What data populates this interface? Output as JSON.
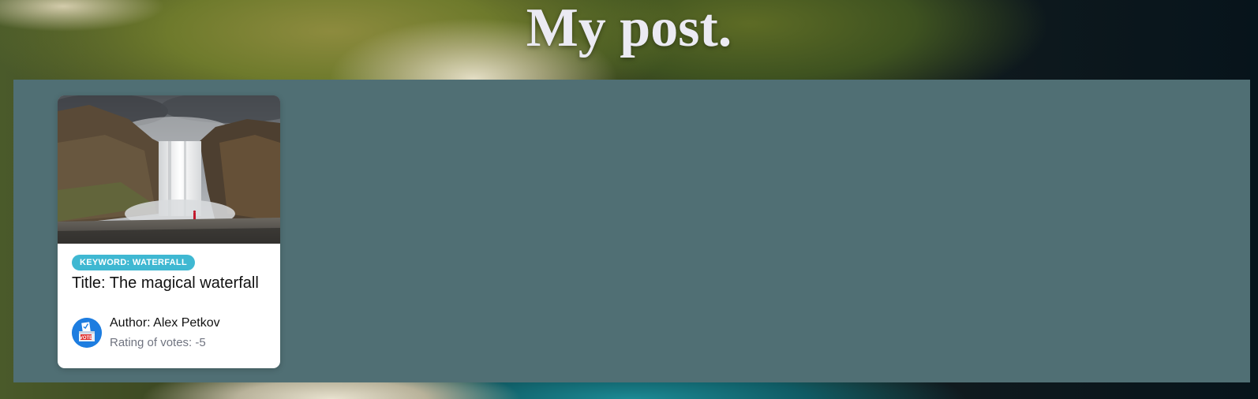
{
  "header": {
    "title": "My post."
  },
  "posts": [
    {
      "image": "waterfall-photo",
      "keyword_label": "KEYWORD: WATERFALL",
      "title": "Title: The magical waterfall",
      "author_avatar": "vote-ballot-box-icon",
      "author": "Author: Alex Petkov",
      "rating": "Rating of votes: -5",
      "avatar_text": "VOTE"
    }
  ],
  "colors": {
    "panel": "#506f74",
    "badge": "#3fb8d2",
    "title_text": "#ebeaf3",
    "avatar_bg": "#1d7de0"
  }
}
